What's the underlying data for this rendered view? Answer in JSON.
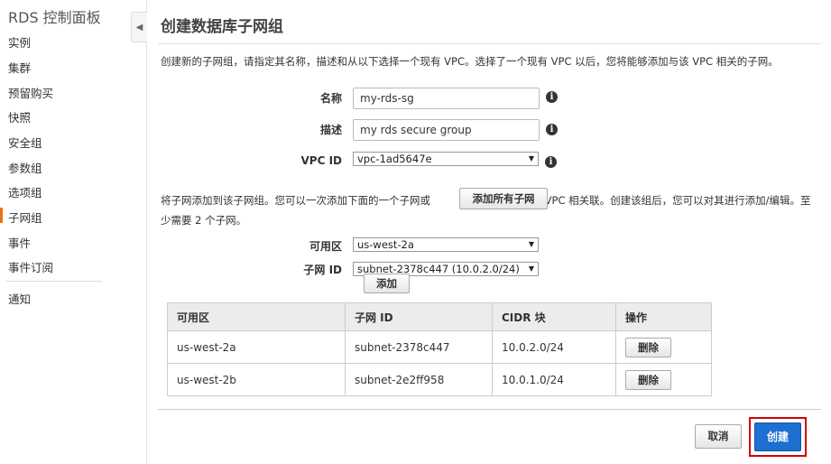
{
  "sidebar": {
    "title": "RDS 控制面板",
    "items": [
      {
        "label": "实例"
      },
      {
        "label": "集群"
      },
      {
        "label": "预留购买"
      },
      {
        "label": "快照"
      },
      {
        "label": "安全组"
      },
      {
        "label": "参数组"
      },
      {
        "label": "选项组"
      },
      {
        "label": "子网组"
      },
      {
        "label": "事件"
      },
      {
        "label": "事件订阅"
      },
      {
        "label": "通知"
      }
    ]
  },
  "page": {
    "title": "创建数据库子网组",
    "intro": "创建新的子网组，请指定其名称，描述和从以下选择一个现有 VPC。选择了一个现有 VPC 以后，您将能够添加与该 VPC 相关的子网。"
  },
  "form": {
    "name_label": "名称",
    "name_value": "my-rds-sg",
    "desc_label": "描述",
    "desc_value": "my rds secure group",
    "vpc_label": "VPC ID",
    "vpc_value": "vpc-1ad5647e"
  },
  "subnet_section": {
    "text_before": "将子网添加到该子网组。您可以一次添加下面的一个子网或",
    "add_all_label": "添加所有子网",
    "text_after": "与该 VPC 相关联。创建该组后，您可以对其进行添加/编辑。至少需要 2 个子网。",
    "az_label": "可用区",
    "az_value": "us-west-2a",
    "subnet_label": "子网 ID",
    "subnet_value": "subnet-2378c447 (10.0.2.0/24)",
    "add_label": "添加"
  },
  "table": {
    "headers": [
      "可用区",
      "子网 ID",
      "CIDR 块",
      "操作"
    ],
    "rows": [
      {
        "az": "us-west-2a",
        "subnet": "subnet-2378c447",
        "cidr": "10.0.2.0/24",
        "action": "删除"
      },
      {
        "az": "us-west-2b",
        "subnet": "subnet-2e2ff958",
        "cidr": "10.0.1.0/24",
        "action": "删除"
      }
    ]
  },
  "footer": {
    "cancel_label": "取消",
    "create_label": "创建"
  },
  "colors": {
    "primary": "#1d6fd1",
    "highlight": "#d40000",
    "active_nav": "#ec7211"
  }
}
